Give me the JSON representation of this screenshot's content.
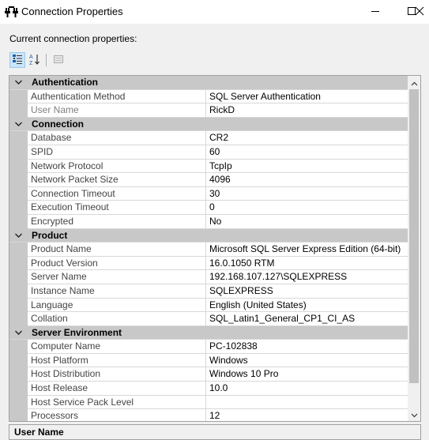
{
  "window": {
    "title": "Connection Properties"
  },
  "caption": "Current connection properties:",
  "icons": {
    "app": "connection-plug-icon",
    "minimize": "minimize-icon",
    "maximize": "maximize-icon",
    "close": "close-icon",
    "categorized": "categorized-view-icon",
    "alphabetical": "alphabetical-sort-icon",
    "property_pages": "property-pages-icon",
    "collapse": "chevron-down-icon",
    "scroll_up": "scroll-up-icon",
    "scroll_down": "scroll-down-icon"
  },
  "grid": {
    "categories": [
      {
        "label": "Authentication",
        "rows": [
          {
            "name": "Authentication Method",
            "value": "SQL Server Authentication"
          },
          {
            "name": "User Name",
            "value": "RickD",
            "dim": true
          }
        ]
      },
      {
        "label": "Connection",
        "rows": [
          {
            "name": "Database",
            "value": "CR2"
          },
          {
            "name": "SPID",
            "value": "60"
          },
          {
            "name": "Network Protocol",
            "value": "TcpIp"
          },
          {
            "name": "Network Packet Size",
            "value": "4096"
          },
          {
            "name": "Connection Timeout",
            "value": "30"
          },
          {
            "name": "Execution Timeout",
            "value": "0"
          },
          {
            "name": "Encrypted",
            "value": "No"
          }
        ]
      },
      {
        "label": "Product",
        "rows": [
          {
            "name": "Product Name",
            "value": "Microsoft SQL Server Express Edition (64-bit)"
          },
          {
            "name": "Product Version",
            "value": "16.0.1050 RTM"
          },
          {
            "name": "Server Name",
            "value": "192.168.107.127\\SQLEXPRESS"
          },
          {
            "name": "Instance Name",
            "value": "SQLEXPRESS"
          },
          {
            "name": "Language",
            "value": "English (United States)"
          },
          {
            "name": "Collation",
            "value": "SQL_Latin1_General_CP1_CI_AS"
          }
        ]
      },
      {
        "label": "Server Environment",
        "rows": [
          {
            "name": "Computer Name",
            "value": "PC-102838"
          },
          {
            "name": "Host Platform",
            "value": "Windows"
          },
          {
            "name": "Host Distribution",
            "value": "Windows 10 Pro"
          },
          {
            "name": "Host Release",
            "value": "10.0"
          },
          {
            "name": "Host Service Pack Level",
            "value": ""
          },
          {
            "name": "Processors",
            "value": "12"
          }
        ]
      }
    ]
  },
  "description": {
    "title": "User Name"
  },
  "colors": {
    "category_band": "#c8c8c8",
    "selected_tool": "#cce4f7"
  }
}
